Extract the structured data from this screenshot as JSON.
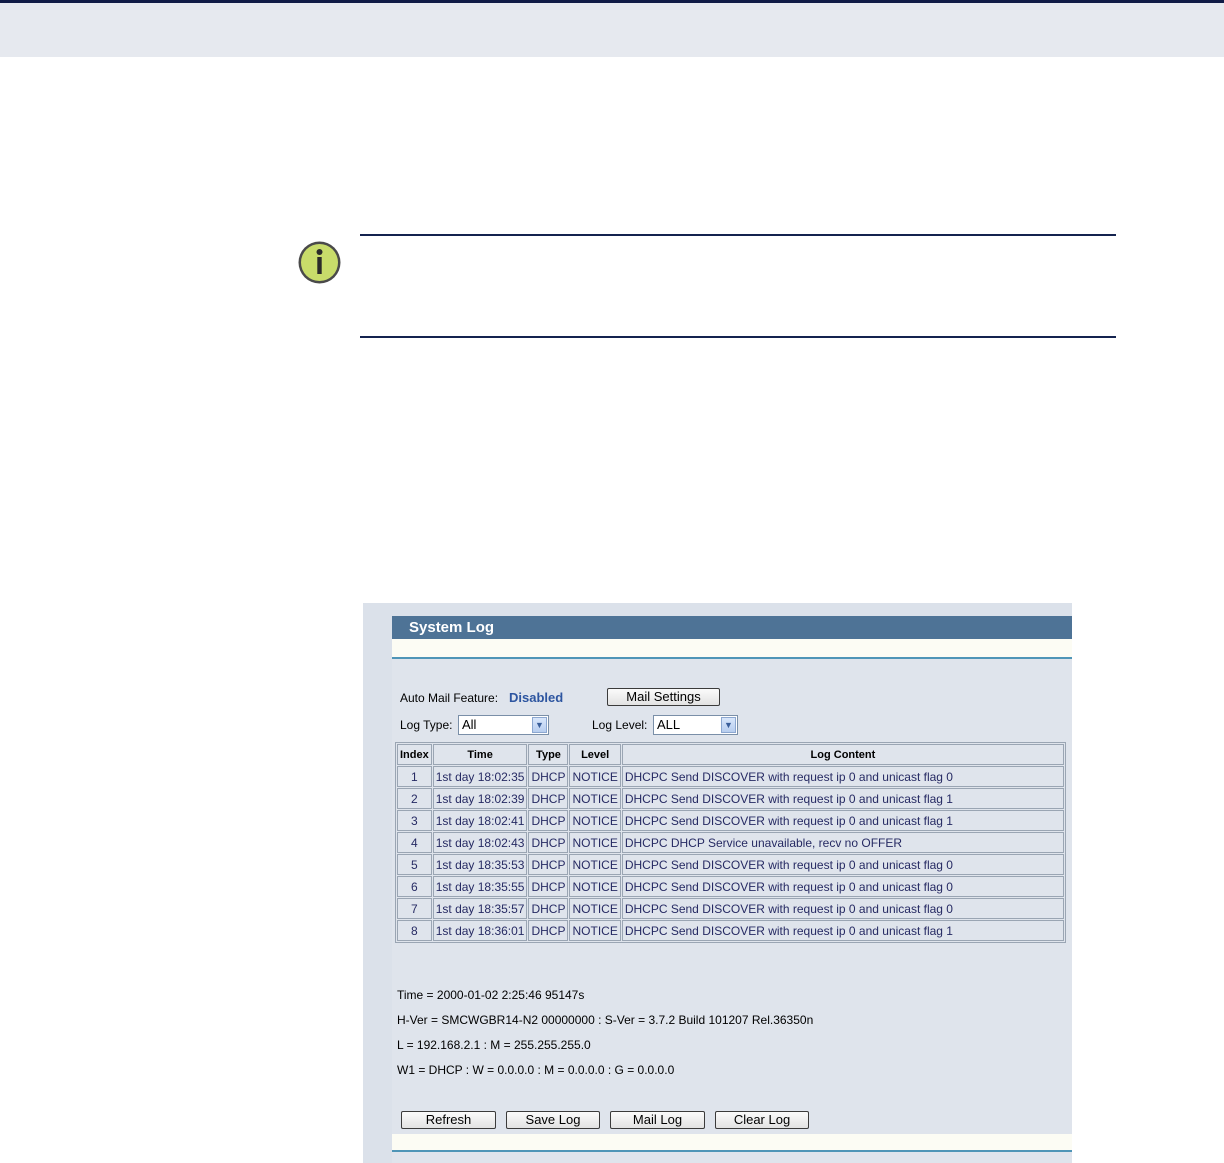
{
  "note": {
    "icon": "info-icon"
  },
  "system_log": {
    "title": "System Log",
    "auto_mail": {
      "label": "Auto Mail Feature:",
      "value": "Disabled",
      "settings_button": "Mail Settings"
    },
    "log_type": {
      "label": "Log Type:",
      "selected": "All"
    },
    "log_level": {
      "label": "Log Level:",
      "selected": "ALL"
    },
    "table": {
      "headers": [
        "Index",
        "Time",
        "Type",
        "Level",
        "Log Content"
      ],
      "rows": [
        [
          "1",
          "1st day 18:02:35",
          "DHCP",
          "NOTICE",
          "DHCPC Send DISCOVER with request ip 0 and unicast flag 0"
        ],
        [
          "2",
          "1st day 18:02:39",
          "DHCP",
          "NOTICE",
          "DHCPC Send DISCOVER with request ip 0 and unicast flag 1"
        ],
        [
          "3",
          "1st day 18:02:41",
          "DHCP",
          "NOTICE",
          "DHCPC Send DISCOVER with request ip 0 and unicast flag 1"
        ],
        [
          "4",
          "1st day 18:02:43",
          "DHCP",
          "NOTICE",
          "DHCPC DHCP Service unavailable, recv no OFFER"
        ],
        [
          "5",
          "1st day 18:35:53",
          "DHCP",
          "NOTICE",
          "DHCPC Send DISCOVER with request ip 0 and unicast flag 0"
        ],
        [
          "6",
          "1st day 18:35:55",
          "DHCP",
          "NOTICE",
          "DHCPC Send DISCOVER with request ip 0 and unicast flag 0"
        ],
        [
          "7",
          "1st day 18:35:57",
          "DHCP",
          "NOTICE",
          "DHCPC Send DISCOVER with request ip 0 and unicast flag 0"
        ],
        [
          "8",
          "1st day 18:36:01",
          "DHCP",
          "NOTICE",
          "DHCPC Send DISCOVER with request ip 0 and unicast flag 1"
        ]
      ]
    },
    "info": {
      "time": "Time = 2000-01-02 2:25:46 95147s",
      "version": "H-Ver = SMCWGBR14-N2 00000000 : S-Ver = 3.7.2 Build 101207 Rel.36350n",
      "lan": "L = 192.168.2.1 : M = 255.255.255.0",
      "wan": "W1 = DHCP : W = 0.0.0.0 : M = 0.0.0.0 : G = 0.0.0.0"
    },
    "buttons": {
      "refresh": "Refresh",
      "save": "Save Log",
      "mail": "Mail Log",
      "clear": "Clear Log"
    }
  }
}
